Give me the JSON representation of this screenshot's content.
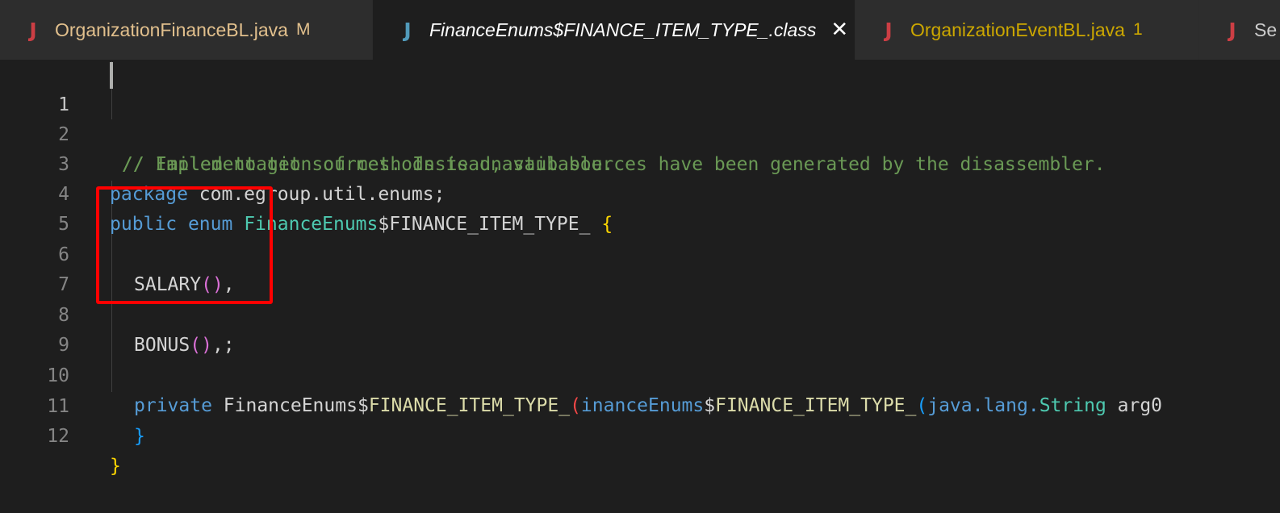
{
  "tabs": [
    {
      "name": "OrganizationFinanceBL.java",
      "status": "M",
      "icon": "J",
      "icon_name": "java-file-icon",
      "color": "#e2c08d",
      "icon_color": "#cc3e44"
    },
    {
      "name": "FinanceEnums$FINANCE_ITEM_TYPE_.class",
      "icon": "J",
      "icon_name": "java-class-icon",
      "color": "#ffffff",
      "icon_color": "#519aba",
      "active": true,
      "close_label": "✕"
    },
    {
      "name": "OrganizationEventBL.java",
      "status": "1",
      "icon": "J",
      "icon_name": "java-file-icon",
      "color": "#cca700",
      "icon_color": "#cc3e44"
    },
    {
      "name": "Se",
      "icon": "J",
      "icon_name": "java-file-icon",
      "color": "#cccccc",
      "icon_color": "#cc3e44"
    }
  ],
  "editor": {
    "current_line": 1,
    "line_numbers": [
      "1",
      "2",
      "3",
      "4",
      "5",
      "6",
      "7",
      "8",
      "9",
      "10",
      "11",
      "12"
    ],
    "lines": {
      "l1": {
        "comment": "// Failed to get sources. Instead, stub sources have been generated by the disassembler."
      },
      "l2": {
        "comment": "// Implementation of methods is unavailable."
      },
      "l3": {
        "kw": "package",
        "rest": " com.egroup.util.enums;"
      },
      "l4": {
        "kw1": "public",
        "kw2": "enum",
        "type": "FinanceEnums",
        "rest": "$FINANCE_ITEM_TYPE_ ",
        "brace": "{"
      },
      "l6": {
        "name": "SALARY",
        "parens": "()",
        "tail": ","
      },
      "l8": {
        "name": "BONUS",
        "parens": "()",
        "tail": ",;"
      },
      "l10": {
        "kw": "private",
        "p1": " FinanceEnums$",
        "p2": "FINANCE_ITEM_TYPE_",
        "paren1": "(",
        "p3": "inanceEnums",
        "p4": "$",
        "p5": "FINANCE_ITEM_TYPE_",
        "paren2": "(",
        "p6": "java.lang.",
        "p7": "String",
        "p8": " arg0"
      },
      "l11": {
        "brace": "}"
      },
      "l12": {
        "brace": "}"
      }
    }
  },
  "colors": {
    "editor_bg": "#1e1e1e",
    "tabbar_bg": "#252526",
    "highlight_box": "#ff0000"
  }
}
